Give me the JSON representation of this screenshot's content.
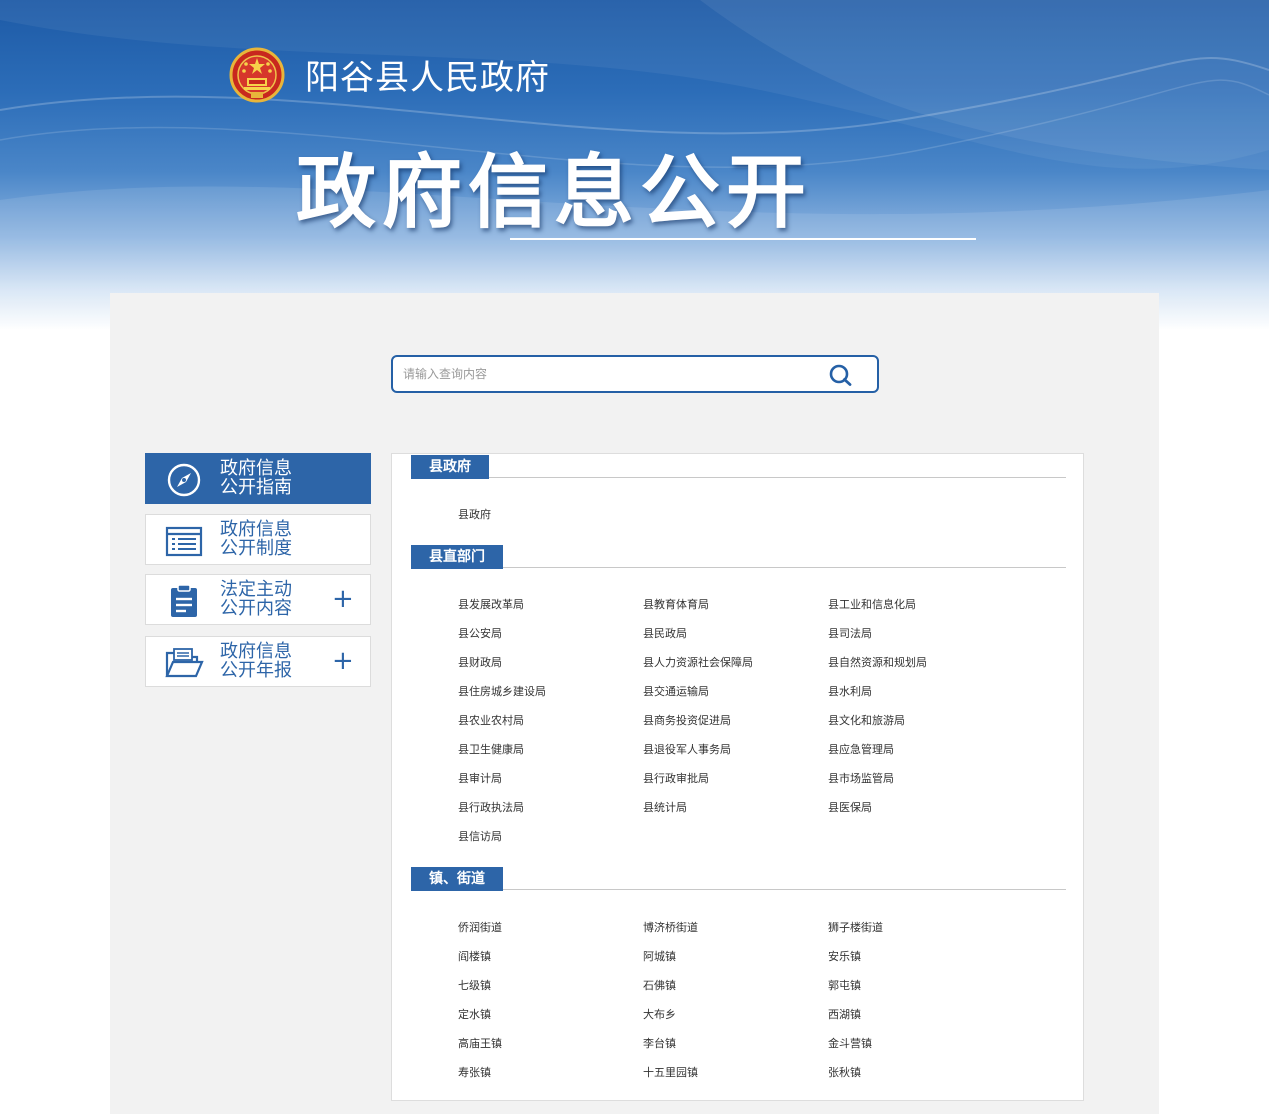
{
  "header": {
    "site_name": "阳谷县人民政府",
    "title": "政府信息公开",
    "emblem_icon": "national-emblem-icon"
  },
  "search": {
    "placeholder": "请输入查询内容",
    "icon": "search-icon"
  },
  "sidebar": {
    "items": [
      {
        "line1": "政府信息",
        "line2": "公开指南",
        "icon": "compass-icon",
        "active": true,
        "expandable": false
      },
      {
        "line1": "政府信息",
        "line2": "公开制度",
        "icon": "document-list-icon",
        "active": false,
        "expandable": false
      },
      {
        "line1": "法定主动",
        "line2": "公开内容",
        "icon": "clipboard-icon",
        "active": false,
        "expandable": true
      },
      {
        "line1": "政府信息",
        "line2": "公开年报",
        "icon": "folder-icon",
        "active": false,
        "expandable": true
      }
    ],
    "plus_label": "+"
  },
  "sections": [
    {
      "title": "县政府",
      "items": [
        "县政府"
      ]
    },
    {
      "title": "县直部门",
      "items": [
        "县发展改革局",
        "县教育体育局",
        "县工业和信息化局",
        "县公安局",
        "县民政局",
        "县司法局",
        "县财政局",
        "县人力资源社会保障局",
        "县自然资源和规划局",
        "县住房城乡建设局",
        "县交通运输局",
        "县水利局",
        "县农业农村局",
        "县商务投资促进局",
        "县文化和旅游局",
        "县卫生健康局",
        "县退役军人事务局",
        "县应急管理局",
        "县审计局",
        "县行政审批局",
        "县市场监管局",
        "县行政执法局",
        "县统计局",
        "县医保局",
        "县信访局"
      ]
    },
    {
      "title": "镇、街道",
      "items": [
        "侨润街道",
        "博济桥街道",
        "狮子楼街道",
        "阎楼镇",
        "阿城镇",
        "安乐镇",
        "七级镇",
        "石佛镇",
        "郭屯镇",
        "定水镇",
        "大布乡",
        "西湖镇",
        "高庙王镇",
        "李台镇",
        "金斗营镇",
        "寿张镇",
        "十五里园镇",
        "张秋镇"
      ]
    }
  ],
  "colors": {
    "primary": "#2d65a8",
    "panel_bg": "#f2f2f2",
    "banner_top": "#1d5aa6"
  }
}
